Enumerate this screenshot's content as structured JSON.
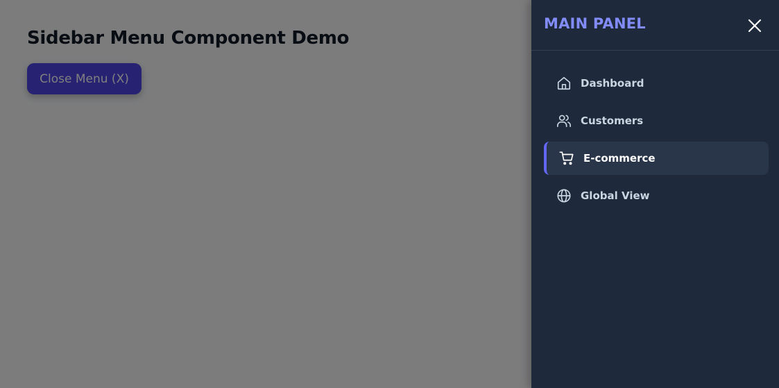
{
  "page": {
    "title": "Sidebar Menu Component Demo",
    "toggle_button_label": "Close Menu (X)"
  },
  "sidebar": {
    "title": "MAIN PANEL",
    "close_icon": "close-icon",
    "items": [
      {
        "label": "Dashboard",
        "icon": "home-icon",
        "active": false
      },
      {
        "label": "Customers",
        "icon": "users-icon",
        "active": false
      },
      {
        "label": "E-commerce",
        "icon": "cart-icon",
        "active": true
      },
      {
        "label": "Global View",
        "icon": "globe-icon",
        "active": false
      }
    ]
  },
  "colors": {
    "accent": "#6366f1",
    "panel_title": "#818cf8",
    "sidebar_bg": "#1e293b",
    "active_item_bg": "#293548",
    "button_bg": "#4f46e5"
  }
}
